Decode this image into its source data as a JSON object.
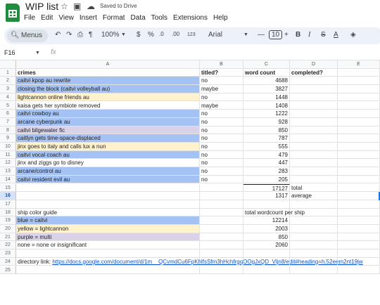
{
  "app": {
    "doc_title": "WIP list",
    "saved_status": "Saved to Drive",
    "menu": [
      "File",
      "Edit",
      "View",
      "Insert",
      "Format",
      "Data",
      "Tools",
      "Extensions",
      "Help"
    ]
  },
  "toolbar": {
    "search_label": "Menus",
    "zoom": "100%",
    "currency": "$",
    "percent": "%",
    "dec_decrease": ".0",
    "dec_increase": ".00",
    "number_format": "123",
    "font": "Arial",
    "font_size": "10",
    "bold": "B",
    "italic": "I",
    "strike": "S",
    "text_color": "A"
  },
  "formula_bar": {
    "cell_ref": "F16",
    "fx": "fx",
    "value": ""
  },
  "columns": [
    "A",
    "B",
    "C",
    "D",
    "E"
  ],
  "rows": [
    {
      "n": "1",
      "A": "crimes",
      "B": "titled?",
      "C": "word count",
      "D": "completed?",
      "E": "",
      "color": "",
      "header": true
    },
    {
      "n": "2",
      "A": "caitvi kpop au rewrite",
      "B": "no",
      "C": "4688",
      "D": "",
      "E": "",
      "color": "blue"
    },
    {
      "n": "3",
      "A": "closing the block (caitvi volleyball au)",
      "B": "maybe",
      "C": "3827",
      "D": "",
      "E": "",
      "color": "blue"
    },
    {
      "n": "4",
      "A": "lightcannon online friends au",
      "B": "no",
      "C": "1448",
      "D": "",
      "E": "",
      "color": "yellow"
    },
    {
      "n": "5",
      "A": "kaisa gets her symbiote removed",
      "B": "maybe",
      "C": "1408",
      "D": "",
      "E": "",
      "color": ""
    },
    {
      "n": "6",
      "A": "caitvi cowboy au",
      "B": "no",
      "C": "1222",
      "D": "",
      "E": "",
      "color": "blue"
    },
    {
      "n": "7",
      "A": "arcane cyberpunk au",
      "B": "no",
      "C": "928",
      "D": "",
      "E": "",
      "color": "blue"
    },
    {
      "n": "8",
      "A": "caitvi bilgewater fic",
      "B": "no",
      "C": "850",
      "D": "",
      "E": "",
      "color": "purple"
    },
    {
      "n": "9",
      "A": "caitlyn gets time-space-displaced",
      "B": "no",
      "C": "787",
      "D": "",
      "E": "",
      "color": "blue"
    },
    {
      "n": "10",
      "A": "jinx goes to italy and calls lux a nun",
      "B": "no",
      "C": "555",
      "D": "",
      "E": "",
      "color": "yellow"
    },
    {
      "n": "11",
      "A": "caitvi vocal coach au",
      "B": "no",
      "C": "479",
      "D": "",
      "E": "",
      "color": "blue"
    },
    {
      "n": "12",
      "A": "jinx and ziggs go to disney",
      "B": "no",
      "C": "447",
      "D": "",
      "E": "",
      "color": ""
    },
    {
      "n": "13",
      "A": "arcane/control au",
      "B": "no",
      "C": "283",
      "D": "",
      "E": "",
      "color": "blue"
    },
    {
      "n": "14",
      "A": "caitvi resident evil au",
      "B": "no",
      "C": "205",
      "D": "",
      "E": "",
      "color": "blue"
    },
    {
      "n": "15",
      "A": "",
      "B": "",
      "C": "17127",
      "D": "total",
      "E": "",
      "color": "",
      "sum": true
    },
    {
      "n": "16",
      "A": "",
      "B": "",
      "C": "1317",
      "D": "average",
      "E": "",
      "color": "",
      "selected": true
    },
    {
      "n": "17",
      "A": "",
      "B": "",
      "C": "",
      "D": "",
      "E": "",
      "color": ""
    },
    {
      "n": "18",
      "A": "ship color guide",
      "B": "",
      "C": "total wordcount per ship",
      "D": "",
      "E": "",
      "color": "",
      "left_c": true
    },
    {
      "n": "19",
      "A": "blue = caitvi",
      "B": "",
      "C": "12214",
      "D": "",
      "E": "",
      "color": "blue"
    },
    {
      "n": "20",
      "A": "yellow = lightcannon",
      "B": "",
      "C": "2003",
      "D": "",
      "E": "",
      "color": "yellow"
    },
    {
      "n": "21",
      "A": "purple = multi",
      "B": "",
      "C": "850",
      "D": "",
      "E": "",
      "color": "purple"
    },
    {
      "n": "22",
      "A": "none = none or insignificant",
      "B": "",
      "C": "2060",
      "D": "",
      "E": "",
      "color": ""
    },
    {
      "n": "23",
      "A": "",
      "B": "",
      "C": "",
      "D": "",
      "E": "",
      "color": ""
    },
    {
      "n": "24",
      "A": "directory link: ",
      "link": "https://docs.google.com/document/d/1m__QCvmdCu6FpKhlfsSfm3hHchfrgqOOgJxQD_Vljn8/edit#heading=h.52eem2nt19jw",
      "B": "",
      "C": "",
      "D": "",
      "E": "",
      "color": ""
    },
    {
      "n": "25",
      "A": "",
      "B": "",
      "C": "",
      "D": "",
      "E": "",
      "color": ""
    }
  ],
  "colors": {
    "blue": "#a4c2f4",
    "yellow": "#fff2cc",
    "purple": "#d9d2e9",
    "selection": "#d3e3fd"
  }
}
